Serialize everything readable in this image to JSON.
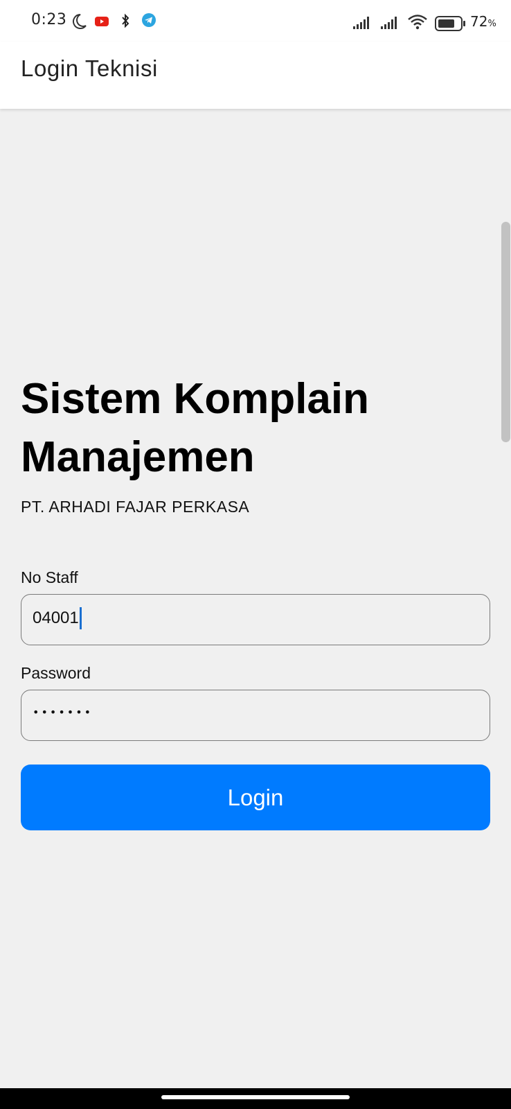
{
  "status_bar": {
    "time": "0:23",
    "battery_percent": "72",
    "battery_percent_sign": "%",
    "icons": [
      "moon-icon",
      "youtube-icon",
      "bluetooth-icon",
      "telegram-icon",
      "signal-icon",
      "signal-icon",
      "wifi-icon",
      "battery-icon"
    ],
    "youtube_color": "#e62117",
    "telegram_color": "#2ca5e0"
  },
  "app_bar": {
    "title": "Login Teknisi"
  },
  "main": {
    "heading": "Sistem Komplain Manajemen",
    "company": "PT. ARHADI FAJAR PERKASA",
    "staff_label": "No Staff",
    "staff_value": "04001",
    "password_label": "Password",
    "password_value": "•••••••",
    "login_label": "Login"
  },
  "colors": {
    "accent": "#007bff",
    "background": "#f0f0f0",
    "cursor": "#1a6fd1"
  }
}
